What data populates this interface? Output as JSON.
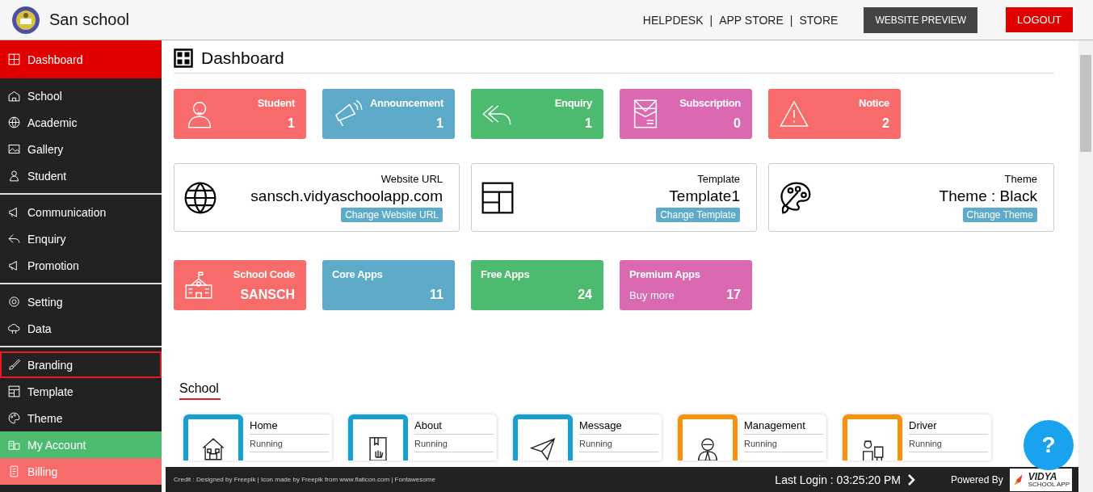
{
  "header": {
    "school_name": "San school",
    "links": [
      "HELPDESK",
      "APP STORE",
      "STORE"
    ],
    "separators": [
      "|",
      "|"
    ],
    "preview_button": "WEBSITE PREVIEW",
    "logout_button": "LOGOUT"
  },
  "sidebar": {
    "groups": [
      [
        {
          "label": "Dashboard",
          "selected": false,
          "color": "#e00000"
        }
      ],
      [
        {
          "label": "School",
          "selected": false
        },
        {
          "label": "Academic",
          "selected": false
        },
        {
          "label": "Gallery",
          "selected": false
        },
        {
          "label": "Student",
          "selected": false
        }
      ],
      [
        {
          "label": "Communication",
          "selected": false
        },
        {
          "label": "Enquiry",
          "selected": false
        },
        {
          "label": "Promotion",
          "selected": false
        }
      ],
      [
        {
          "label": "Setting",
          "selected": false
        },
        {
          "label": "Data",
          "selected": false
        }
      ],
      [
        {
          "label": "Branding",
          "selected": true
        },
        {
          "label": "Template",
          "selected": false
        },
        {
          "label": "Theme",
          "selected": false
        },
        {
          "label": "My Account",
          "selected": false,
          "color": "#4cbb6f"
        },
        {
          "label": "Billing",
          "selected": false,
          "color": "#f76b6b"
        }
      ]
    ]
  },
  "page_title": "Dashboard",
  "stats": [
    {
      "label": "Student",
      "value": "1",
      "color": "#f76b6b"
    },
    {
      "label": "Announcement",
      "value": "1",
      "color": "#5dabc9"
    },
    {
      "label": "Enquiry",
      "value": "1",
      "color": "#4cbb6f"
    },
    {
      "label": "Subscription",
      "value": "0",
      "color": "#db69b2"
    },
    {
      "label": "Notice",
      "value": "2",
      "color": "#f76b6b"
    }
  ],
  "info_cards": [
    {
      "label": "Website URL",
      "value": "sansch.vidyaschoolapp.com",
      "button": "Change Website URL"
    },
    {
      "label": "Template",
      "value": "Template1",
      "button": "Change Template"
    },
    {
      "label": "Theme",
      "value": "Theme : Black",
      "button": "Change Theme"
    }
  ],
  "app_stats": [
    {
      "label": "School Code",
      "value": "SANSCH",
      "color": "#f76b6b"
    },
    {
      "label": "Core Apps",
      "value": "11",
      "color": "#5dabc9"
    },
    {
      "label": "Free Apps",
      "value": "24",
      "color": "#4cbb6f"
    },
    {
      "label": "Premium Apps",
      "value": "17",
      "note": "Buy more",
      "color": "#db69b2"
    }
  ],
  "section_title": "School",
  "apps": [
    {
      "name": "Home",
      "state": "Running",
      "color": "#15a0cf"
    },
    {
      "name": "About",
      "state": "Running",
      "color": "#15a0cf"
    },
    {
      "name": "Message",
      "state": "Running",
      "color": "#15a0cf"
    },
    {
      "name": "Management",
      "state": "Running",
      "color": "#f7920e"
    },
    {
      "name": "Driver",
      "state": "Running",
      "color": "#f7920e"
    }
  ],
  "help_button": "?",
  "footer": {
    "credit": "Credit : Designed by Freepik | Icon made by Freepik from www.flaticon.com | Fontawesome",
    "last_login": "Last Login : 03:25:20 PM",
    "powered_by": "Powered By",
    "brand": "VIDYA",
    "brand_sub": "SCHOOL APP"
  }
}
